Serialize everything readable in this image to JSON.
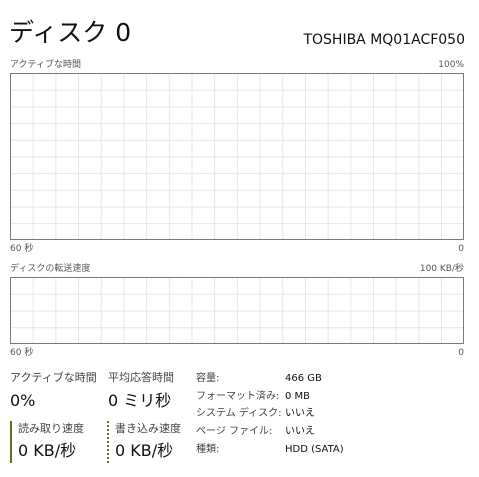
{
  "header": {
    "title": "ディスク 0",
    "model": "TOSHIBA MQ01ACF050"
  },
  "active_time_graph": {
    "label": "アクティブな時間",
    "max_label": "100%",
    "time_label": "60 秒",
    "min_label": "0"
  },
  "transfer_graph": {
    "label": "ディスクの転送速度",
    "max_label": "100 KB/秒",
    "time_label": "60 秒",
    "min_label": "0"
  },
  "stats": {
    "active_time": {
      "label": "アクティブな時間",
      "value": "0%"
    },
    "avg_response": {
      "label": "平均応答時間",
      "value": "0 ミリ秒"
    },
    "read_speed": {
      "label": "読み取り速度",
      "value": "0 KB/秒"
    },
    "write_speed": {
      "label": "書き込み速度",
      "value": "0 KB/秒"
    }
  },
  "properties": [
    {
      "label": "容量:",
      "value": "466 GB"
    },
    {
      "label": "フォーマット済み:",
      "value": "0 MB"
    },
    {
      "label": "システム ディスク:",
      "value": "いいえ"
    },
    {
      "label": "ページ ファイル:",
      "value": "いいえ"
    },
    {
      "label": "種類:",
      "value": "HDD (SATA)"
    }
  ],
  "colors": {
    "graph_border": "#7a7a7a",
    "grid_line": "#e6e6e6",
    "disk_accent": "#6b6b1e"
  }
}
